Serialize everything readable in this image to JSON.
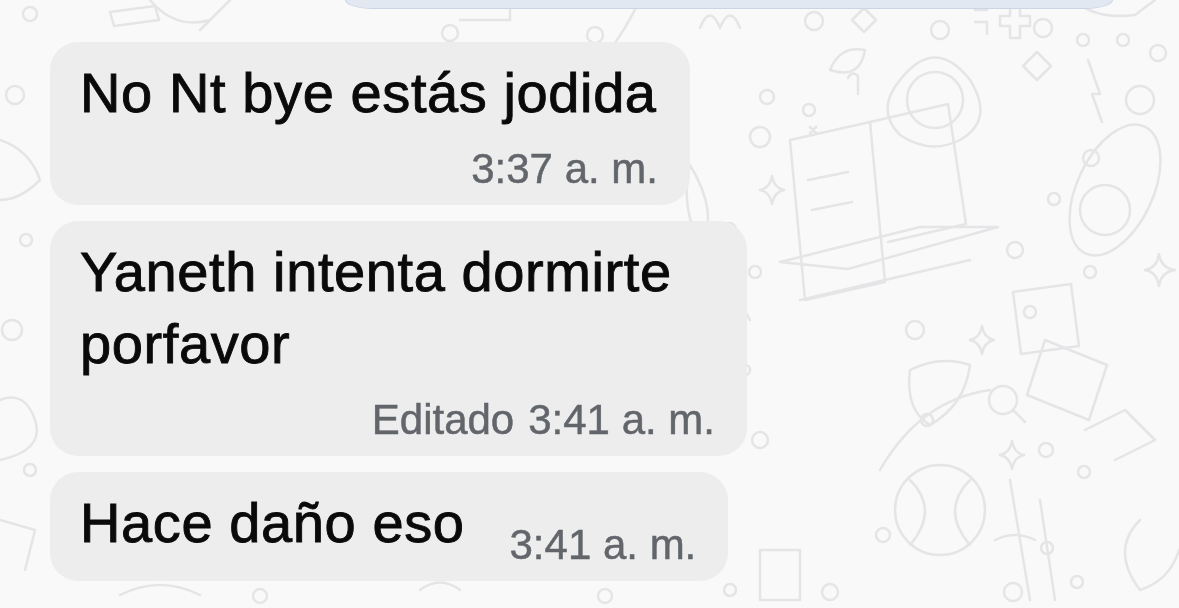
{
  "messages": [
    {
      "kind": "outgoing"
    },
    {
      "kind": "incoming",
      "text": "No Nt bye estás jodida",
      "time": "3:37 a. m."
    },
    {
      "kind": "incoming",
      "text": "Yaneth intenta dormirte porfavor",
      "edited_label": "Editado",
      "time": "3:41 a. m."
    },
    {
      "kind": "incoming",
      "text": "Hace daño eso",
      "time": "3:41 a. m."
    }
  ]
}
